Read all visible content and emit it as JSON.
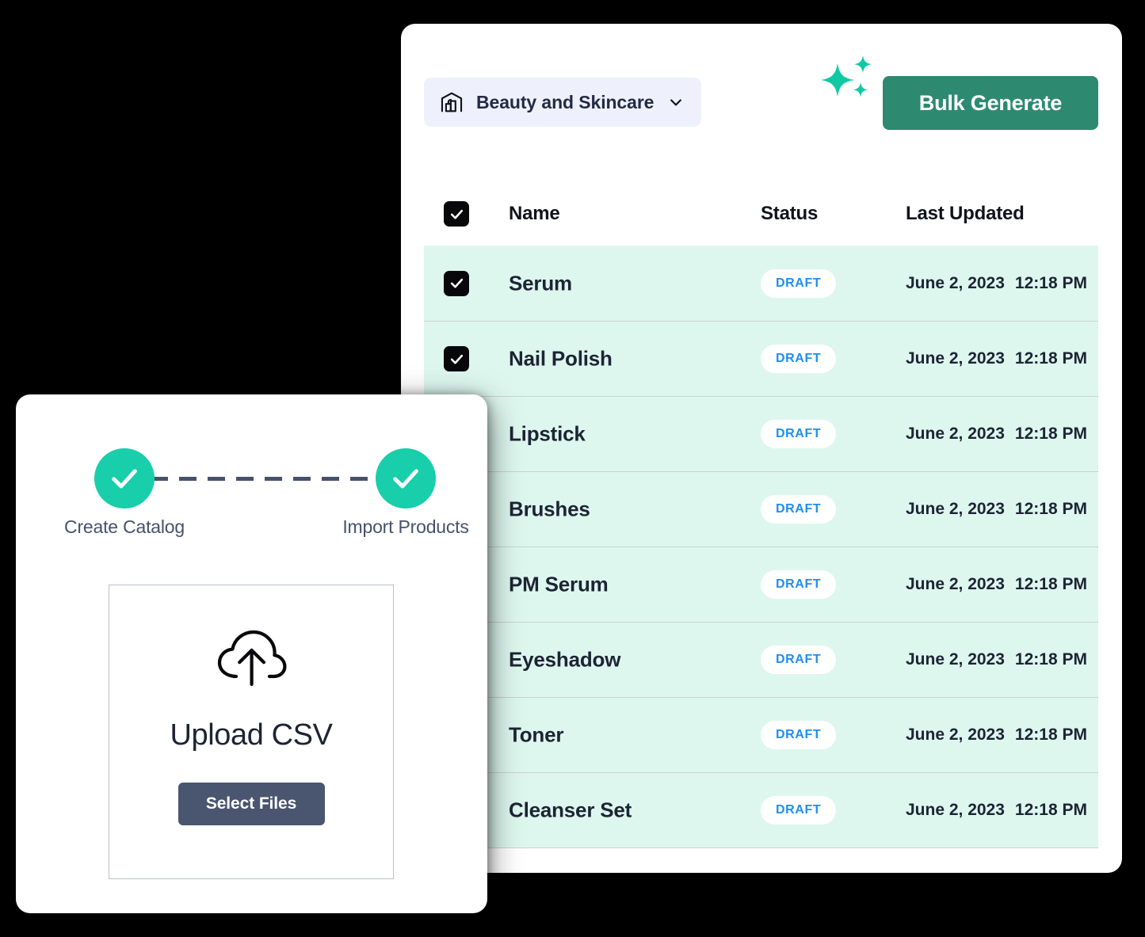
{
  "products_panel": {
    "catalog_selector": {
      "label": "Beauty and Skincare",
      "icon": "warehouse-icon",
      "chevron": "chevron-down-icon",
      "background": "#eef1fb"
    },
    "bulk_generate": {
      "label": "Bulk Generate",
      "color": "#2d8a70",
      "sparkle_icon": "sparkles-icon",
      "sparkle_color": "#0fc9a4"
    },
    "table": {
      "columns": [
        "Name",
        "Status",
        "Last Updated"
      ],
      "header_checkbox_checked": true,
      "row_background": "#ddf7ef",
      "badge_text_color": "#1f8ef1",
      "rows": [
        {
          "name": "Serum",
          "status": "DRAFT",
          "date": "June 2, 2023",
          "time": "12:18 PM",
          "checked": true,
          "show_checkbox": true
        },
        {
          "name": "Nail Polish",
          "status": "DRAFT",
          "date": "June 2, 2023",
          "time": "12:18 PM",
          "checked": true,
          "show_checkbox": true
        },
        {
          "name": "Lipstick",
          "status": "DRAFT",
          "date": "June 2, 2023",
          "time": "12:18 PM",
          "checked": false,
          "show_checkbox": false
        },
        {
          "name": "Brushes",
          "status": "DRAFT",
          "date": "June 2, 2023",
          "time": "12:18 PM",
          "checked": false,
          "show_checkbox": false
        },
        {
          "name": "PM Serum",
          "status": "DRAFT",
          "date": "June 2, 2023",
          "time": "12:18 PM",
          "checked": false,
          "show_checkbox": false
        },
        {
          "name": "Eyeshadow",
          "status": "DRAFT",
          "date": "June 2, 2023",
          "time": "12:18 PM",
          "checked": false,
          "show_checkbox": false
        },
        {
          "name": "Toner",
          "status": "DRAFT",
          "date": "June 2, 2023",
          "time": "12:18 PM",
          "checked": false,
          "show_checkbox": false
        },
        {
          "name": "Cleanser Set",
          "status": "DRAFT",
          "date": "June 2, 2023",
          "time": "12:18 PM",
          "checked": false,
          "show_checkbox": false
        }
      ]
    }
  },
  "import_panel": {
    "steps": [
      {
        "label": "Create Catalog",
        "complete": true,
        "icon": "check-circle-icon"
      },
      {
        "label": "Import Products",
        "complete": true,
        "icon": "check-circle-icon"
      }
    ],
    "step_color": "#18ceab",
    "connector_color": "#46516b",
    "upload": {
      "icon": "cloud-upload-icon",
      "title": "Upload CSV",
      "button_label": "Select Files",
      "button_color": "#4a566f"
    }
  }
}
